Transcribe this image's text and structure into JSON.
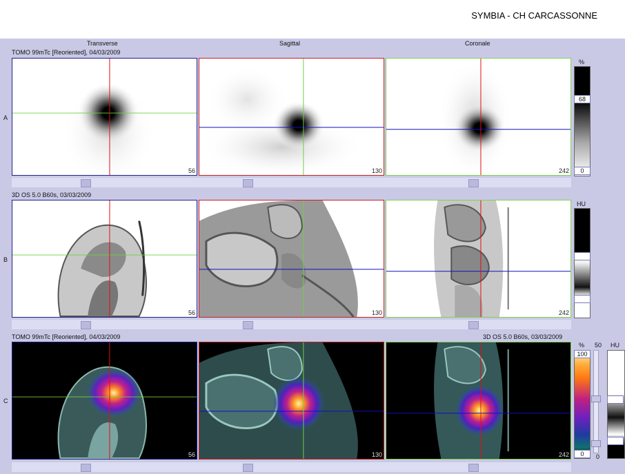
{
  "app": {
    "title": "SYMBIA - CH CARCASSONNE"
  },
  "columns": [
    "Transverse",
    "Sagittal",
    "Coronale"
  ],
  "rows": [
    {
      "letter": "A",
      "caption": "TOMO 99mTc [Reoriented], 04/03/2009",
      "slices": [
        "56",
        "130",
        "242"
      ]
    },
    {
      "letter": "B",
      "caption": "3D  OS  5.0  B60s, 03/03/2009",
      "slices": [
        "56",
        "130",
        "242"
      ]
    },
    {
      "letter": "C",
      "caption": "TOMO 99mTc [Reoriented], 04/03/2009",
      "caption_right": "3D  OS  5.0  B60s, 03/03/2009",
      "slices": [
        "56",
        "130",
        "242"
      ]
    }
  ],
  "colorbars": {
    "a": {
      "unit": "%",
      "value": "68",
      "min": "0"
    },
    "b": {
      "unit": "HU"
    },
    "c": {
      "unit_left": "%",
      "max": "100",
      "min": "0",
      "unit_mid": "50",
      "unit_right": "HU",
      "min_mid": "0"
    }
  },
  "colors": {
    "background": "#c9c9e6",
    "transverse_border": "#20208a",
    "sagittal_border": "#c82020",
    "coronal_border": "#80d050",
    "cross_red": "#e01010",
    "cross_green": "#70d040",
    "cross_blue": "#1010c0"
  }
}
